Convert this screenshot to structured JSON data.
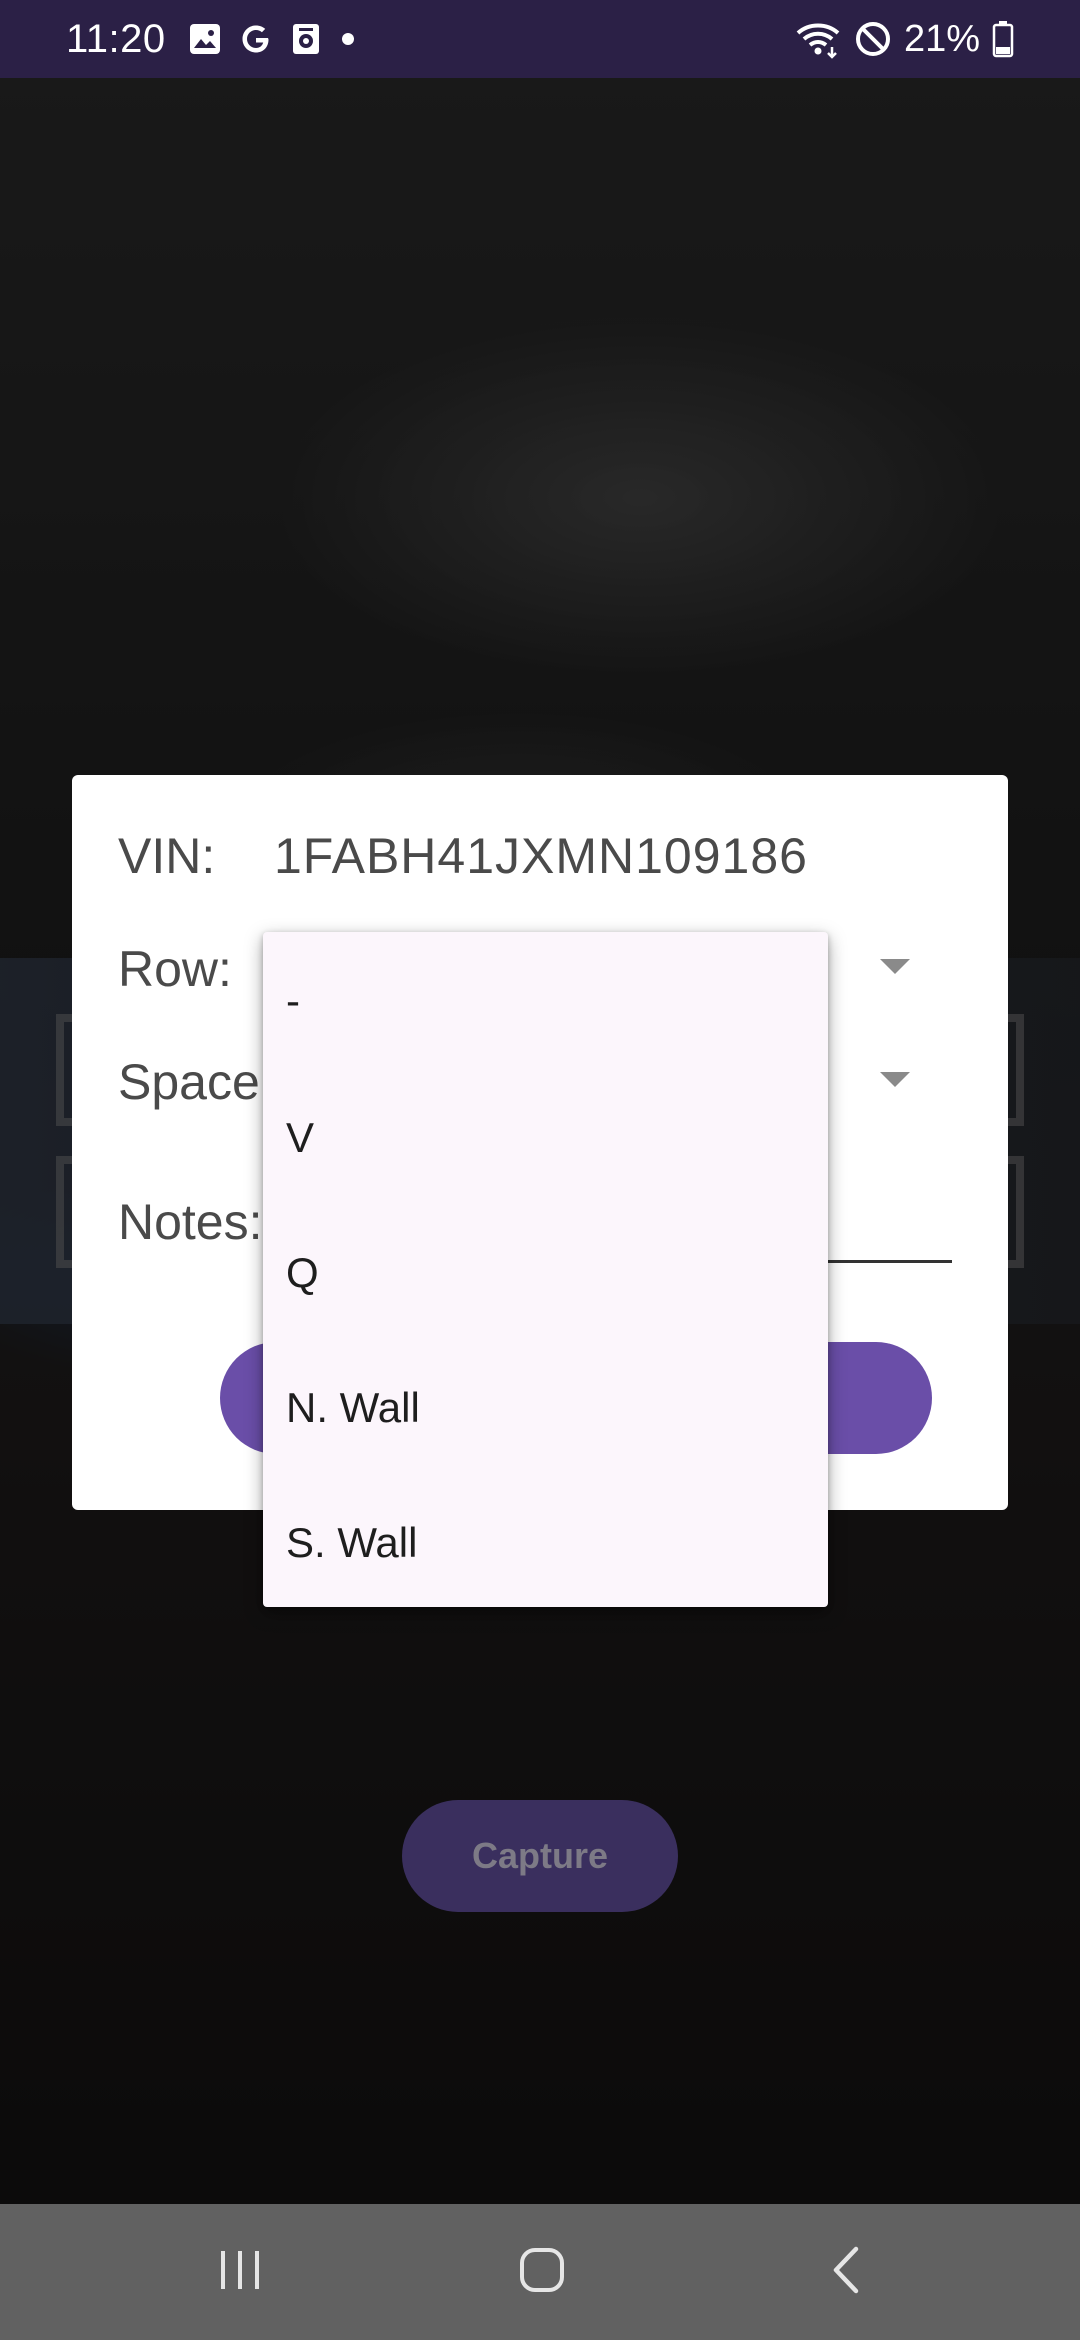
{
  "status_bar": {
    "time": "11:20",
    "battery": "21%",
    "left_icons": [
      "gallery-icon",
      "google-icon",
      "media-icon",
      "dot-icon"
    ],
    "right_icons": [
      "wifi-icon",
      "do-not-disturb-icon",
      "battery-icon"
    ]
  },
  "dialog": {
    "vin_label": "VIN:",
    "vin_value": "1FABH41JXMN109186",
    "row_label": "Row:",
    "space_label": "Space",
    "notes_label": "Notes:"
  },
  "dropdown": {
    "options": [
      "-",
      "V",
      "Q",
      "N. Wall",
      "S. Wall"
    ]
  },
  "capture_button": "Capture",
  "nav_bar": {
    "icons": [
      "recent-apps-icon",
      "home-icon",
      "back-icon"
    ]
  },
  "colors": {
    "status_bar": "#2b2046",
    "accent": "#6a4ea8",
    "dropdown_bg": "#fcf6fc",
    "nav_bar": "#616161"
  }
}
